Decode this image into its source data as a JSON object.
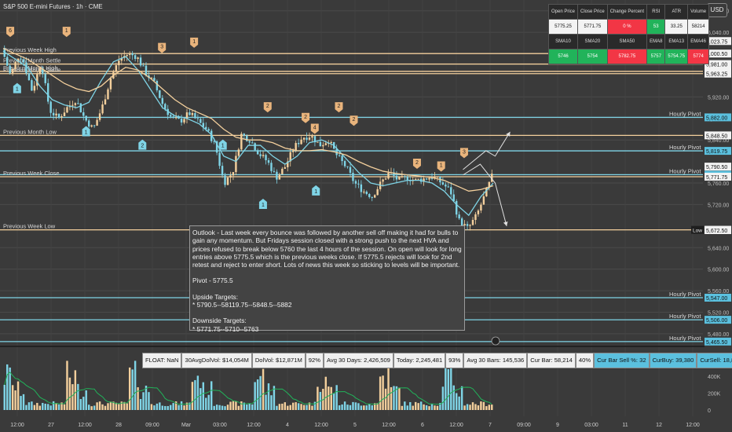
{
  "header": {
    "symbol_title": "S&P 500 E-mini Futures · 1h · CME",
    "currency_button": "USD"
  },
  "stats_table": {
    "row1_headers": [
      "Open Price",
      "Close Price",
      "Change Percent",
      "RSI",
      "ATR",
      "Volume"
    ],
    "row1_values": [
      "5775.25",
      "5771.75",
      "0 %",
      "53",
      "33.25",
      "58214"
    ],
    "row2_headers": [
      "SMA10",
      "SMA20",
      "SMA50",
      "EMA8",
      "EMA13",
      "EMA46"
    ],
    "row2_values": [
      "5746",
      "5754",
      "5782.75",
      "5757",
      "5754.75",
      "5774"
    ],
    "row1_styles": [
      "w",
      "w",
      "r",
      "g",
      "w",
      "w"
    ],
    "row2_styles": [
      "g",
      "g",
      "r",
      "g",
      "g",
      "r"
    ]
  },
  "price_axis": {
    "ticks": [
      {
        "value": 6080,
        "label": "6,080.00"
      },
      {
        "value": 6040,
        "label": "6,040.00"
      },
      {
        "value": 5920,
        "label": "5,920.00"
      },
      {
        "value": 5880,
        "label": "5,880.00"
      },
      {
        "value": 5840,
        "label": "5,840.00"
      },
      {
        "value": 5760,
        "label": "5,760.00"
      },
      {
        "value": 5720,
        "label": "5,720.00"
      },
      {
        "value": 5640,
        "label": "5,640.00"
      },
      {
        "value": 5600,
        "label": "5,600.00"
      },
      {
        "value": 5560,
        "label": "5,560.00"
      },
      {
        "value": 5520,
        "label": "5,520.00"
      },
      {
        "value": 5480,
        "label": "5,480.00"
      }
    ],
    "price_tags": [
      {
        "value": 6023.75,
        "label": "6,023.75",
        "style": "white",
        "side_label": "High"
      },
      {
        "value": 6000.5,
        "label": "6,000.50",
        "style": "white"
      },
      {
        "value": 5981.0,
        "label": "5,981.00",
        "style": "white"
      },
      {
        "value": 5967.5,
        "label": "5,967.50",
        "style": "white"
      },
      {
        "value": 5963.25,
        "label": "5,963.25",
        "style": "white"
      },
      {
        "value": 5882.0,
        "label": "5,882.00",
        "style": "blue"
      },
      {
        "value": 5848.5,
        "label": "5,848.50",
        "style": "white"
      },
      {
        "value": 5819.75,
        "label": "5,819.75",
        "style": "blue"
      },
      {
        "value": 5790.5,
        "label": "5,790.50",
        "style": "white"
      },
      {
        "value": 5775.5,
        "label": "5,775.50",
        "style": "blue"
      },
      {
        "value": 5771.75,
        "label": "5,771.75",
        "style": "white"
      },
      {
        "value": 5673.0,
        "label": "5,673.00",
        "style": "white",
        "side_label": "Low"
      },
      {
        "value": 5673.0,
        "label": "5,673.00",
        "style": "white"
      },
      {
        "value": 5672.5,
        "label": "5,672.50",
        "style": "white"
      },
      {
        "value": 5547.0,
        "label": "5,547.00",
        "style": "blue"
      },
      {
        "value": 5506.0,
        "label": "5,506.00",
        "style": "blue"
      },
      {
        "value": 5465.5,
        "label": "5,465.50",
        "style": "blue"
      }
    ]
  },
  "volume_axis": {
    "ticks": [
      {
        "value": 600000,
        "label": "600K"
      },
      {
        "value": 400000,
        "label": "400K"
      },
      {
        "value": 200000,
        "label": "200K"
      },
      {
        "value": 0,
        "label": "0"
      }
    ]
  },
  "time_axis": {
    "labels": [
      "12:00",
      "27",
      "12:00",
      "28",
      "09:00",
      "Mar",
      "03:00",
      "12:00",
      "4",
      "12:00",
      "5",
      "12:00",
      "6",
      "12:00",
      "7",
      "09:00",
      "9",
      "03:00",
      "11",
      "12",
      "12:00"
    ]
  },
  "chart_data": {
    "type": "candlestick",
    "title": "S&P 500 E-mini Futures · 1h · CME",
    "price_range": [
      5458,
      6100
    ],
    "volume_range": [
      0,
      650000
    ],
    "grid": true,
    "price_path": [
      [
        0,
        6010
      ],
      [
        0.4,
        5960
      ],
      [
        0.8,
        6000
      ],
      [
        1,
        5985
      ],
      [
        1.4,
        5930
      ],
      [
        1.8,
        5985
      ],
      [
        2.2,
        5895
      ],
      [
        2.6,
        5880
      ],
      [
        3,
        5900
      ],
      [
        3.4,
        5915
      ],
      [
        3.8,
        5880
      ],
      [
        4.2,
        5860
      ],
      [
        4.6,
        5900
      ],
      [
        5,
        5955
      ],
      [
        5.4,
        5990
      ],
      [
        5.8,
        6000
      ],
      [
        6.2,
        5995
      ],
      [
        6.6,
        5965
      ],
      [
        7,
        5945
      ],
      [
        7.4,
        5905
      ],
      [
        7.8,
        5880
      ],
      [
        8.2,
        5875
      ],
      [
        8.6,
        5890
      ],
      [
        9,
        5875
      ],
      [
        9.4,
        5860
      ],
      [
        9.8,
        5830
      ],
      [
        10.2,
        5760
      ],
      [
        10.6,
        5780
      ],
      [
        11,
        5850
      ],
      [
        11.4,
        5840
      ],
      [
        11.8,
        5815
      ],
      [
        12.2,
        5800
      ],
      [
        12.6,
        5770
      ],
      [
        13,
        5790
      ],
      [
        13.4,
        5825
      ],
      [
        13.8,
        5845
      ],
      [
        14.2,
        5848
      ],
      [
        14.6,
        5830
      ],
      [
        15,
        5840
      ],
      [
        15.4,
        5810
      ],
      [
        15.8,
        5790
      ],
      [
        16.2,
        5760
      ],
      [
        16.6,
        5745
      ],
      [
        17,
        5735
      ],
      [
        17.4,
        5760
      ],
      [
        17.8,
        5780
      ],
      [
        18.2,
        5765
      ],
      [
        18.6,
        5770
      ],
      [
        19,
        5765
      ],
      [
        19.4,
        5768
      ],
      [
        19.8,
        5772
      ],
      [
        20.2,
        5760
      ],
      [
        20.6,
        5745
      ],
      [
        21,
        5690
      ],
      [
        21.4,
        5675
      ],
      [
        21.8,
        5700
      ],
      [
        22.2,
        5740
      ],
      [
        22.5,
        5772
      ]
    ],
    "series": [
      {
        "name": "",
        "color": "#7fd4e6",
        "values": [
          6005,
          5990,
          5975,
          5940,
          5915,
          5905,
          5900,
          5910,
          5950,
          5985,
          5995,
          5970,
          5935,
          5900,
          5885,
          5880,
          5870,
          5850,
          5810,
          5800,
          5830,
          5830,
          5810,
          5795,
          5810,
          5835,
          5840,
          5830,
          5805,
          5780,
          5760,
          5755,
          5760,
          5765,
          5765,
          5760,
          5745,
          5720,
          5700,
          5735,
          5760
        ]
      },
      {
        "name": "",
        "color": "#f3cf9c",
        "values": [
          6010,
          6000,
          5990,
          5975,
          5960,
          5945,
          5935,
          5930,
          5940,
          5960,
          5975,
          5970,
          5955,
          5935,
          5915,
          5900,
          5890,
          5880,
          5860,
          5845,
          5840,
          5840,
          5835,
          5825,
          5820,
          5820,
          5822,
          5818,
          5812,
          5800,
          5790,
          5782,
          5778,
          5775,
          5773,
          5770,
          5765,
          5755,
          5745,
          5748,
          5755
        ]
      }
    ],
    "horizontal_levels": [
      {
        "price": 6000.5,
        "color": "#f3cf9c",
        "label": "Previous Week High"
      },
      {
        "price": 5981.0,
        "color": "#f3cf9c",
        "label": "Previous Month Settle"
      },
      {
        "price": 5967.5,
        "color": "#f3cf9c",
        "label": "Previous Month High"
      },
      {
        "price": 5963.25,
        "color": "#f3cf9c",
        "label": "Previous Month Settle"
      },
      {
        "price": 5882.0,
        "color": "#7fd4e6",
        "label": "Hourly Pivot"
      },
      {
        "price": 5848.5,
        "color": "#f3cf9c",
        "label": "Previous Month Low"
      },
      {
        "price": 5819.75,
        "color": "#7fd4e6",
        "label": "Hourly Pivot"
      },
      {
        "price": 5775.5,
        "color": "#7fd4e6",
        "label": "Hourly Pivot"
      },
      {
        "price": 5771.75,
        "color": "#f3cf9c",
        "label": "Previous Week Close"
      },
      {
        "price": 5673.0,
        "color": "#f3cf9c",
        "label": "Previous Week Low"
      },
      {
        "price": 5547.0,
        "color": "#7fd4e6",
        "label": "Hourly Pivot"
      },
      {
        "price": 5506.0,
        "color": "#7fd4e6",
        "label": "Hourly Pivot"
      },
      {
        "price": 5465.5,
        "color": "#7fd4e6",
        "label": "Hourly Pivot"
      }
    ],
    "markers": [
      {
        "t": 0.1,
        "price": 6040,
        "label": "6",
        "kind": "top"
      },
      {
        "t": 5.0,
        "price": 6040,
        "label": "1",
        "kind": "top"
      },
      {
        "t": 13.3,
        "price": 6010,
        "label": "3",
        "kind": "top"
      },
      {
        "t": 16.1,
        "price": 6020,
        "label": "1",
        "kind": "top"
      },
      {
        "t": 22.5,
        "price": 5900,
        "label": "2",
        "kind": "top"
      },
      {
        "t": 25.8,
        "price": 5880,
        "label": "2",
        "kind": "top"
      },
      {
        "t": 26.6,
        "price": 5860,
        "label": "4",
        "kind": "top"
      },
      {
        "t": 28.7,
        "price": 5900,
        "label": "2",
        "kind": "top"
      },
      {
        "t": 30.0,
        "price": 5875,
        "label": "2",
        "kind": "top"
      },
      {
        "t": 35.5,
        "price": 5795,
        "label": "2",
        "kind": "top"
      },
      {
        "t": 37.6,
        "price": 5790,
        "label": "1",
        "kind": "top"
      },
      {
        "t": 39.6,
        "price": 5815,
        "label": "3",
        "kind": "top"
      },
      {
        "t": 0.7,
        "price": 5940,
        "label": "1",
        "kind": "bottom"
      },
      {
        "t": 6.7,
        "price": 5860,
        "label": "1",
        "kind": "bottom"
      },
      {
        "t": 11.6,
        "price": 5835,
        "label": "2",
        "kind": "bottom"
      },
      {
        "t": 18.6,
        "price": 5835,
        "label": "1",
        "kind": "bottom"
      },
      {
        "t": 22.1,
        "price": 5725,
        "label": "1",
        "kind": "bottom"
      },
      {
        "t": 26.7,
        "price": 5750,
        "label": "1",
        "kind": "bottom"
      },
      {
        "t": 38.7,
        "price": 5665,
        "label": "1",
        "kind": "bottom"
      }
    ],
    "projection_paths": [
      [
        [
          39.5,
          5775
        ],
        [
          41.0,
          5795
        ],
        [
          42.3,
          5760
        ],
        [
          43.3,
          5680
        ]
      ],
      [
        [
          39.5,
          5785
        ],
        [
          41.5,
          5820
        ],
        [
          42.3,
          5810
        ],
        [
          43.6,
          5855
        ]
      ]
    ]
  },
  "commentary": {
    "paragraph": "Outlook - Last week every bounce was followed by another sell off making it had for bulls to gain any momentum. But Fridays session closed with a strong push to the next HVA and prices refused to break below 5760 the last 4 hours of the session. On open will look for long entries above 5775.5 which is the previous weeks close. If 5775.5 rejects will look for 2nd retest and reject to enter short. Lots of news this week so sticking to levels will be important.",
    "pivot": "Pivot - 5775.5",
    "upside_title": "Upside Targets:",
    "upside_values": "* 5790.5--58119.75--5848.5--5882",
    "downside_title": "Downside Targets:",
    "downside_values": "* 5771.75--5710--5763"
  },
  "volume_stats": [
    {
      "text": "FLOAT: NaN",
      "style": "white"
    },
    {
      "text": "30AvgDolVol: $14,054M",
      "style": "white"
    },
    {
      "text": "DolVol: $12,871M",
      "style": "white"
    },
    {
      "text": "92%",
      "style": "white"
    },
    {
      "text": "Avg 30 Days: 2,426,509",
      "style": "white"
    },
    {
      "text": "Today: 2,245,481",
      "style": "white"
    },
    {
      "text": "93%",
      "style": "white"
    },
    {
      "text": "Avg 30 Bars: 145,536",
      "style": "white"
    },
    {
      "text": "Cur Bar: 58,214",
      "style": "white"
    },
    {
      "text": "40%",
      "style": "white"
    },
    {
      "text": "Cur Bar Sell %: 32",
      "style": "blue"
    },
    {
      "text": "CurBuy: 39,380",
      "style": "blue"
    },
    {
      "text": "CurSell: 18,834",
      "style": "blue"
    }
  ],
  "colors": {
    "background": "#3a3a3a",
    "candle_up": "#f3cf9c",
    "candle_down": "#7fd4e6",
    "volume_up": "#f3cf9c",
    "volume_down": "#7fd4e6",
    "volume_ma": "#21b35a"
  }
}
